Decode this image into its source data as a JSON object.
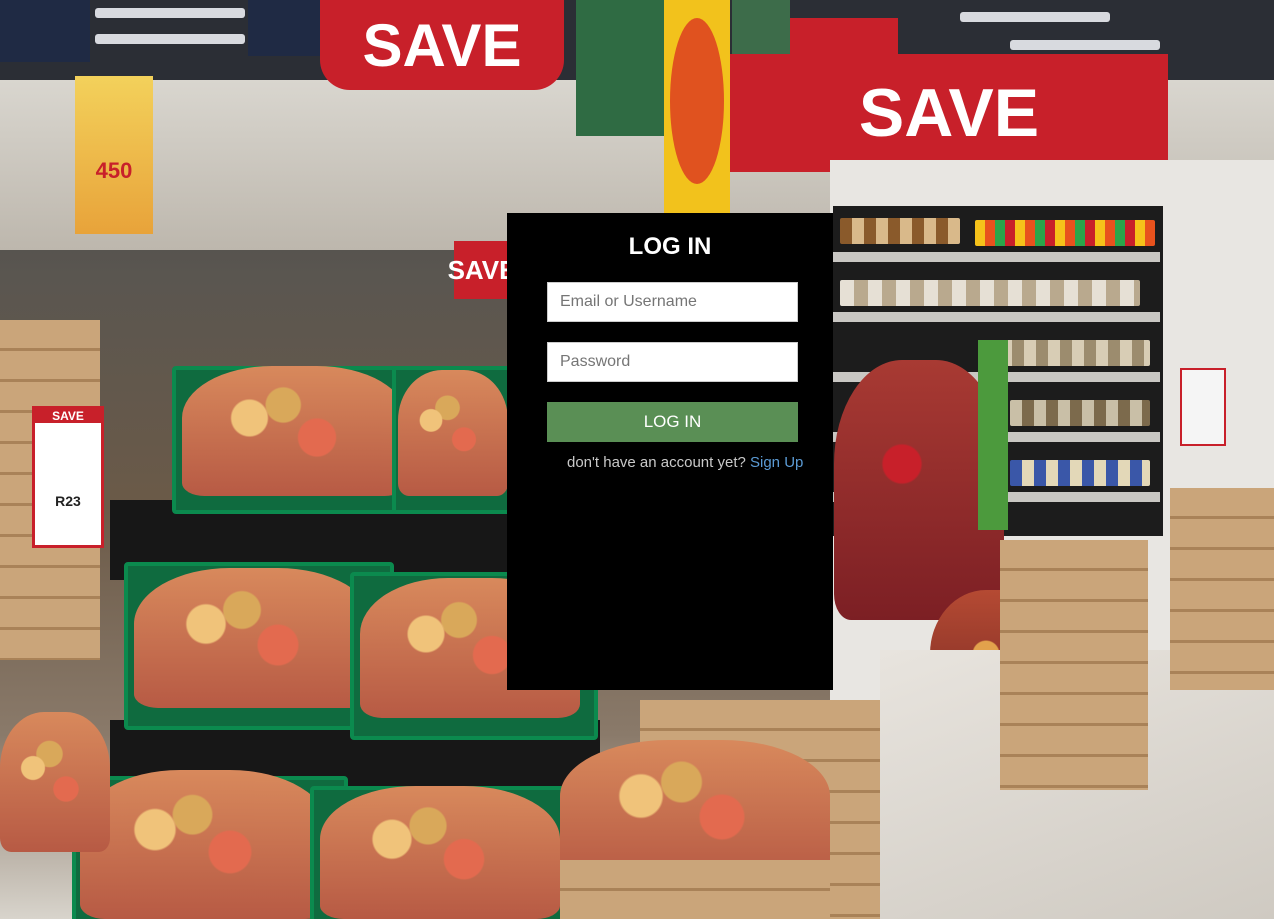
{
  "login": {
    "title": "LOG IN",
    "email_placeholder": "Email or Username",
    "password_placeholder": "Password",
    "submit_label": "LOG IN",
    "signup_prompt": "don't have an account yet?",
    "signup_link": "Sign Up"
  },
  "background": {
    "signs": [
      "SAVE",
      "SAVE",
      "SAVE",
      "SAVE"
    ],
    "price_tag": {
      "header": "SAVE",
      "price": "R23"
    },
    "promo": "450"
  },
  "colors": {
    "panel_bg": "#000000",
    "button_bg": "#5a8f55",
    "link": "#5b9bd5",
    "prompt_text": "#c9c9c9"
  }
}
